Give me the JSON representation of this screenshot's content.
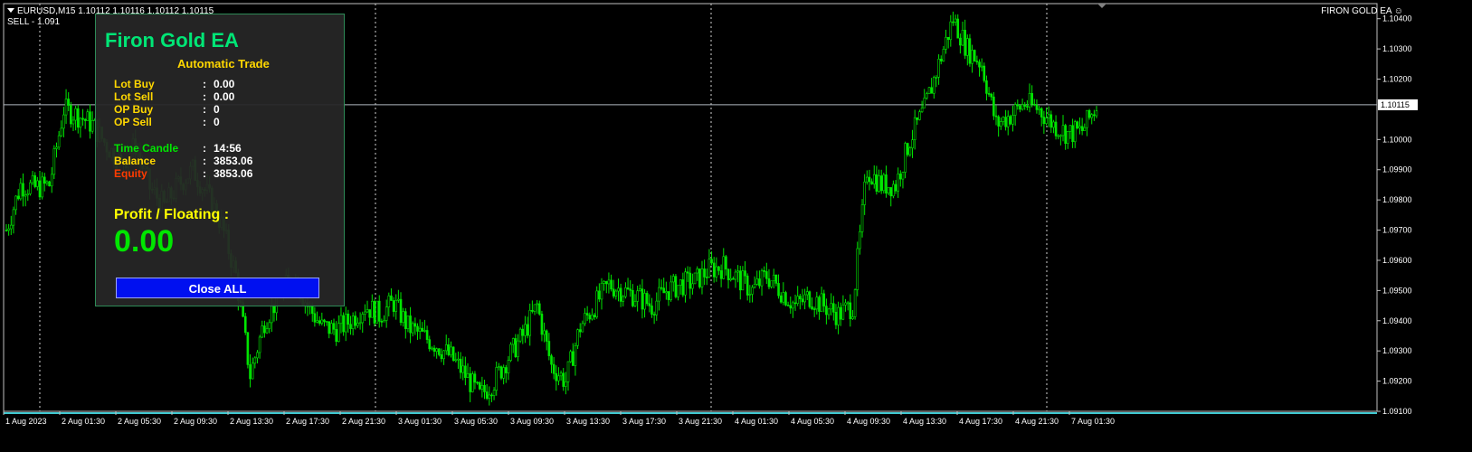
{
  "header": {
    "symbol_info": "EURUSD,M15  1.10112 1.10116 1.10112 1.10115",
    "sell_info": "SELL - 1.091",
    "ea_label": "FIRON GOLD EA ☺"
  },
  "panel": {
    "title": "Firon Gold EA",
    "subtitle": "Automatic Trade",
    "rows": [
      {
        "label": "Lot Buy",
        "value": "0.00",
        "color": "#ffd700"
      },
      {
        "label": "Lot Sell",
        "value": "0.00",
        "color": "#ffd700"
      },
      {
        "label": "OP Buy",
        "value": "0",
        "color": "#ffd700"
      },
      {
        "label": "OP Sell",
        "value": "0",
        "color": "#ffd700"
      },
      {
        "label": "Time Candle",
        "value": "14:56",
        "color": "#00e600"
      },
      {
        "label": "Balance",
        "value": "3853.06",
        "color": "#ffd700"
      },
      {
        "label": "Equity",
        "value": "3853.06",
        "color": "#ff3b00"
      }
    ],
    "colon": ":",
    "profit_label": "Profit / Floating  :",
    "profit_value": "0.00",
    "close_button": "Close ALL"
  },
  "chart_data": {
    "type": "candlestick",
    "symbol": "EURUSD",
    "timeframe": "M15",
    "current_price": "1.10115",
    "ylim": [
      1.091,
      1.1045
    ],
    "y_ticks": [
      "1.10400",
      "1.10300",
      "1.10200",
      "1.10000",
      "1.09900",
      "1.09800",
      "1.09700",
      "1.09600",
      "1.09500",
      "1.09400",
      "1.09300",
      "1.09200",
      "1.09100"
    ],
    "x_ticks": [
      "1 Aug 2023",
      "2 Aug 01:30",
      "2 Aug 05:30",
      "2 Aug 09:30",
      "2 Aug 13:30",
      "2 Aug 17:30",
      "2 Aug 21:30",
      "3 Aug 01:30",
      "3 Aug 05:30",
      "3 Aug 09:30",
      "3 Aug 13:30",
      "3 Aug 17:30",
      "3 Aug 21:30",
      "4 Aug 01:30",
      "4 Aug 05:30",
      "4 Aug 09:30",
      "4 Aug 13:30",
      "4 Aug 17:30",
      "4 Aug 21:30",
      "7 Aug 01:30"
    ],
    "series": [
      {
        "values": [
          1.097,
          1.0985,
          1.0984,
          1.0985,
          1.101,
          1.1008,
          1.1005,
          1.0998,
          1.0992,
          1.0998,
          1.0984,
          1.0978,
          1.0985,
          1.099,
          1.0982,
          1.0972,
          1.0955,
          1.0922,
          1.094,
          1.0948,
          1.0955,
          1.0945,
          1.0938,
          1.0937,
          1.094,
          1.0945,
          1.0942,
          1.0946,
          1.0938,
          1.0935,
          1.0932,
          1.0928,
          1.0922,
          1.0915,
          1.092,
          1.0928,
          1.0935,
          1.0945,
          1.0925,
          1.092,
          1.0938,
          1.0945,
          1.0952,
          1.095,
          1.0948,
          1.0945,
          1.095,
          1.0952,
          1.0953,
          1.0957,
          1.0958,
          1.0954,
          1.095,
          1.0955,
          1.095,
          1.0945,
          1.0948,
          1.0945,
          1.0942,
          1.0945,
          1.099,
          1.0985,
          1.0985,
          1.1,
          1.101,
          1.1025,
          1.104,
          1.103,
          1.1025,
          1.1005,
          1.1008,
          1.1012,
          1.101,
          1.1005,
          1.1002,
          1.1003,
          1.1011
        ]
      }
    ],
    "grid": "vertical dotted",
    "up_color": "#00e600",
    "down_color": "#00e600"
  }
}
